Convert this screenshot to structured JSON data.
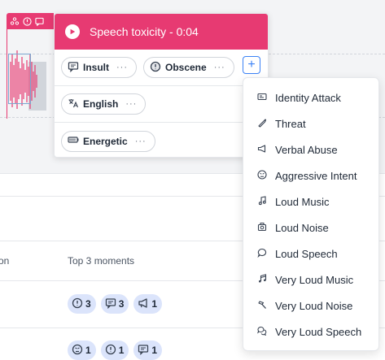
{
  "popup": {
    "title": "Speech toxicity - 0:04",
    "tags_row1": [
      {
        "label": "Insult",
        "icon": "chat-bubble-icon",
        "more": "···"
      },
      {
        "label": "Obscene",
        "icon": "alert-circle-icon",
        "more": "···"
      }
    ],
    "language_tag": {
      "label": "English",
      "icon": "translate-icon",
      "more": "···"
    },
    "emotion_tag": {
      "label": "Energetic",
      "icon": "battery-icon",
      "more": "···"
    },
    "add_label": "+"
  },
  "menu": {
    "items": [
      {
        "label": "Identity Attack",
        "icon": "id-card-icon"
      },
      {
        "label": "Threat",
        "icon": "knife-icon"
      },
      {
        "label": "Verbal Abuse",
        "icon": "megaphone-icon"
      },
      {
        "label": "Aggressive Intent",
        "icon": "angry-face-icon"
      },
      {
        "label": "Loud Music",
        "icon": "music-note-icon"
      },
      {
        "label": "Loud Noise",
        "icon": "speaker-icon"
      },
      {
        "label": "Loud Speech",
        "icon": "speech-bubble-icon"
      },
      {
        "label": "Very Loud Music",
        "icon": "music-notes-icon"
      },
      {
        "label": "Very Loud Noise",
        "icon": "hammer-icon"
      },
      {
        "label": "Very Loud Speech",
        "icon": "speech-bubbles-icon"
      }
    ]
  },
  "table": {
    "col_partial": "on",
    "col_moments": "Top 3 moments",
    "row1": [
      {
        "icon": "alert-circle-icon",
        "count": "3"
      },
      {
        "icon": "chat-bubble-icon",
        "count": "3"
      },
      {
        "icon": "megaphone-icon",
        "count": "1"
      }
    ],
    "row2": [
      {
        "icon": "angry-face-icon",
        "count": "1"
      },
      {
        "icon": "alert-circle-icon",
        "count": "1"
      },
      {
        "icon": "chat-bubble-icon",
        "count": "1"
      }
    ]
  },
  "colors": {
    "accent": "#e73a72",
    "chip_bg": "#dbe4fb",
    "add_blue": "#3b82f6"
  }
}
